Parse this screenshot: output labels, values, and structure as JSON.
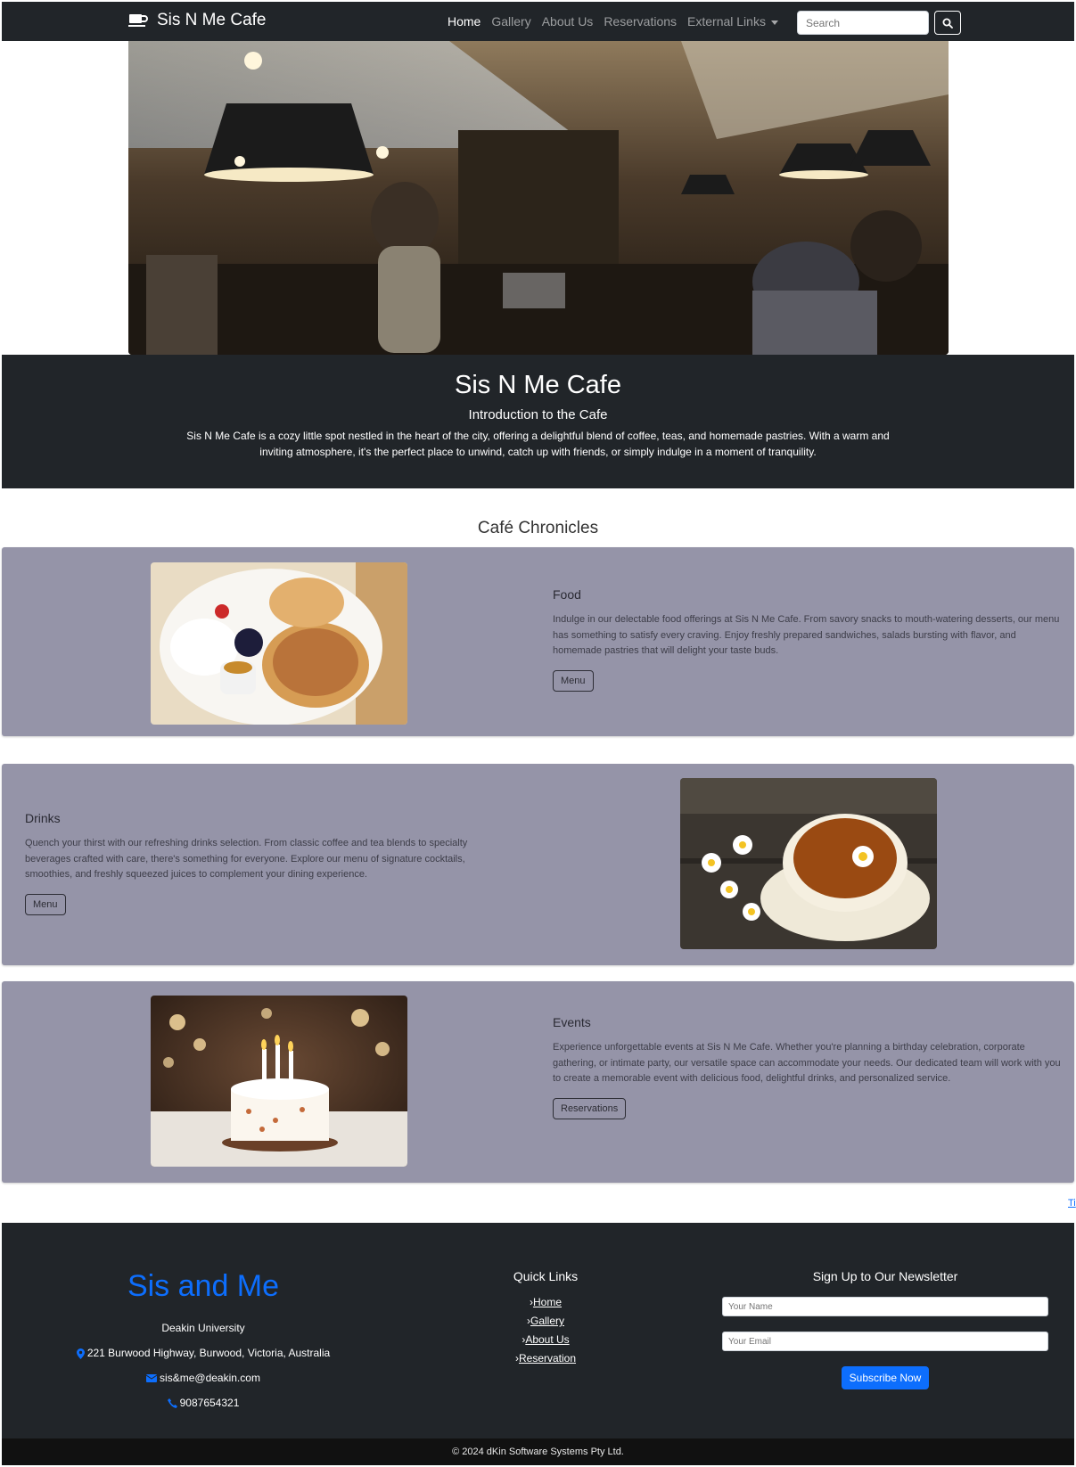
{
  "nav": {
    "brand": "Sis N Me Cafe",
    "links": [
      "Home",
      "Gallery",
      "About Us",
      "Reservations",
      "External Links"
    ],
    "search_placeholder": "Search"
  },
  "intro": {
    "title": "Sis N Me Cafe",
    "subtitle": "Introduction to the Cafe",
    "text": "Sis N Me Cafe is a cozy little spot nestled in the heart of the city, offering a delightful blend of coffee, teas, and homemade pastries. With a warm and inviting atmosphere, it's the perfect place to unwind, catch up with friends, or simply indulge in a moment of tranquility."
  },
  "section_title": "Café Chronicles",
  "features": [
    {
      "title": "Food",
      "text": "Indulge in our delectable food offerings at Sis N Me Cafe. From savory snacks to mouth-watering desserts, our menu has something to satisfy every craving. Enjoy freshly prepared sandwiches, salads bursting with flavor, and homemade pastries that will delight your taste buds.",
      "button": "Menu"
    },
    {
      "title": "Drinks",
      "text": "Quench your thirst with our refreshing drinks selection. From classic coffee and tea blends to specialty beverages crafted with care, there's something for everyone. Explore our menu of signature cocktails, smoothies, and freshly squeezed juices to complement your dining experience.",
      "button": "Menu"
    },
    {
      "title": "Events",
      "text": "Experience unforgettable events at Sis N Me Cafe. Whether you're planning a birthday celebration, corporate gathering, or intimate party, our versatile space can accommodate your needs. Our dedicated team will work with you to create a memorable event with delicious food, delightful drinks, and personalized service.",
      "button": "Reservations"
    }
  ],
  "stray_link": "Ti",
  "footer": {
    "brand": "Sis and Me",
    "org": "Deakin University",
    "address": "221 Burwood Highway, Burwood, Victoria, Australia",
    "email": "sis&me@deakin.com",
    "phone": "9087654321",
    "quick_links_title": "Quick Links",
    "quick_links": [
      "Home",
      "Gallery",
      "About Us",
      "Reservation"
    ],
    "newsletter_title": "Sign Up to Our Newsletter",
    "name_placeholder": "Your Name",
    "email_placeholder": "Your Email",
    "subscribe": "Subscribe Now"
  },
  "copyright": "© 2024 dKin Software Systems Pty Ltd.",
  "colors": {
    "dark": "#212529",
    "feature_bg": "#9594a8",
    "accent": "#0d6efd"
  }
}
